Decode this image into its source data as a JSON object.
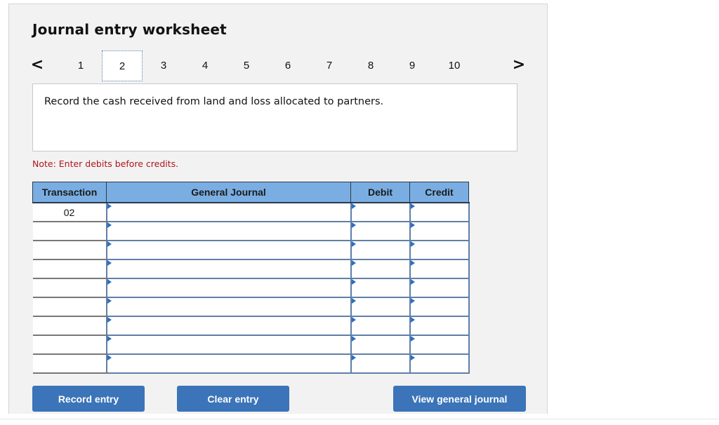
{
  "title": "Journal entry worksheet",
  "pager": {
    "prev_icon": "chevron-left-icon",
    "next_icon": "chevron-right-icon",
    "prev_glyph": "<",
    "next_glyph": ">",
    "pages": [
      "1",
      "2",
      "3",
      "4",
      "5",
      "6",
      "7",
      "8",
      "9",
      "10"
    ],
    "active_page": "2"
  },
  "prompt": "Record the cash received from land and loss allocated to partners.",
  "note": "Note: Enter debits before credits.",
  "table": {
    "headers": {
      "transaction": "Transaction",
      "general_journal": "General Journal",
      "debit": "Debit",
      "credit": "Credit"
    },
    "rows": [
      {
        "transaction": "02",
        "account": "",
        "debit": "",
        "credit": ""
      },
      {
        "transaction": "",
        "account": "",
        "debit": "",
        "credit": ""
      },
      {
        "transaction": "",
        "account": "",
        "debit": "",
        "credit": ""
      },
      {
        "transaction": "",
        "account": "",
        "debit": "",
        "credit": ""
      },
      {
        "transaction": "",
        "account": "",
        "debit": "",
        "credit": ""
      },
      {
        "transaction": "",
        "account": "",
        "debit": "",
        "credit": ""
      },
      {
        "transaction": "",
        "account": "",
        "debit": "",
        "credit": ""
      },
      {
        "transaction": "",
        "account": "",
        "debit": "",
        "credit": ""
      },
      {
        "transaction": "",
        "account": "",
        "debit": "",
        "credit": ""
      }
    ]
  },
  "buttons": {
    "record": "Record entry",
    "clear": "Clear entry",
    "view": "View general journal"
  },
  "colors": {
    "header_blue": "#7aaee3",
    "button_blue": "#3b74b8",
    "note_red": "#b0141b",
    "cell_border": "#5f7fa8"
  }
}
